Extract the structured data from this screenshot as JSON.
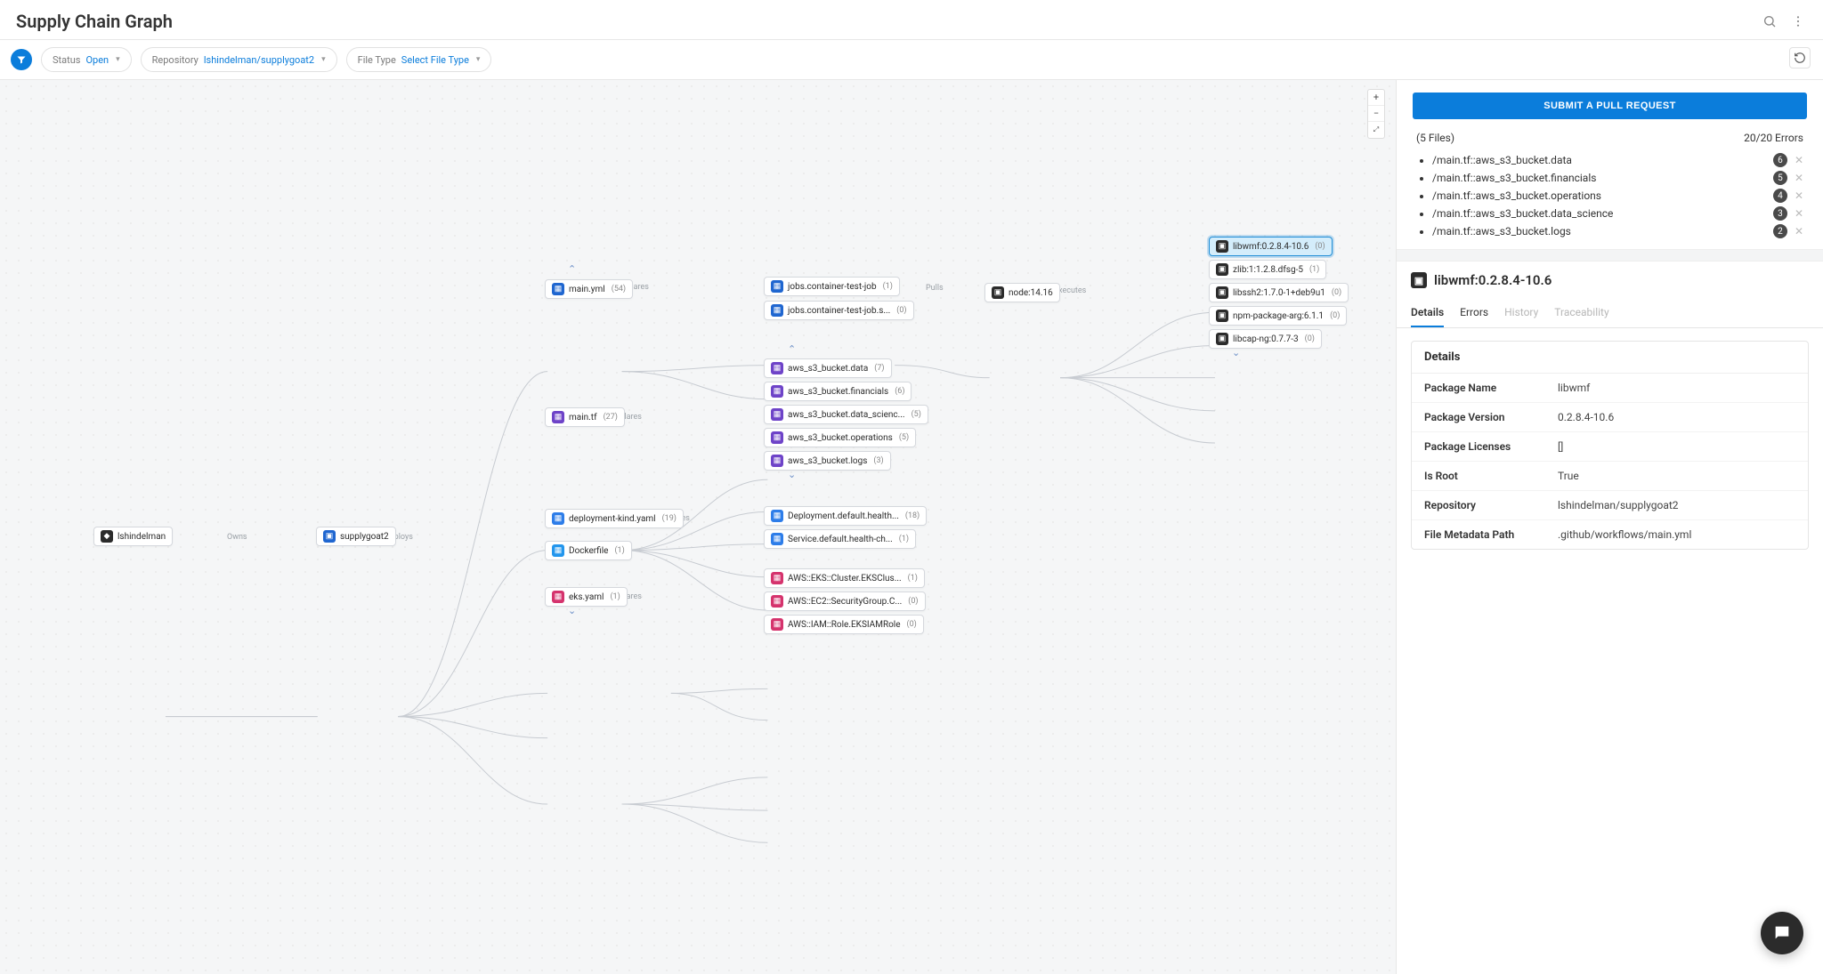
{
  "header": {
    "title": "Supply Chain Graph"
  },
  "filters": {
    "status_label": "Status",
    "status_value": "Open",
    "repo_label": "Repository",
    "repo_value": "lshindelman/supplygoat2",
    "filetype_label": "File Type",
    "filetype_value": "Select File Type"
  },
  "panel": {
    "submit": "SUBMIT A PULL REQUEST",
    "files_label": "(5 Files)",
    "errors_label": "20/20 Errors",
    "files": [
      {
        "path": "/main.tf::aws_s3_bucket.data",
        "count": "6"
      },
      {
        "path": "/main.tf::aws_s3_bucket.financials",
        "count": "5"
      },
      {
        "path": "/main.tf::aws_s3_bucket.operations",
        "count": "4"
      },
      {
        "path": "/main.tf::aws_s3_bucket.data_science",
        "count": "3"
      },
      {
        "path": "/main.tf::aws_s3_bucket.logs",
        "count": "2"
      }
    ],
    "selected_title": "libwmf:0.2.8.4-10.6",
    "tabs": {
      "details": "Details",
      "errors": "Errors",
      "history": "History",
      "traceability": "Traceability"
    },
    "details_heading": "Details",
    "details": [
      {
        "k": "Package Name",
        "v": "libwmf"
      },
      {
        "k": "Package Version",
        "v": "0.2.8.4-10.6"
      },
      {
        "k": "Package Licenses",
        "v": "[]"
      },
      {
        "k": "Is Root",
        "v": "True"
      },
      {
        "k": "Repository",
        "v": "lshindelman/supplygoat2"
      },
      {
        "k": "File Metadata Path",
        "v": ".github/workflows/main.yml"
      }
    ]
  },
  "edges": {
    "owns": "Owns",
    "deploys": "Deploys",
    "declares": "Declares",
    "pulls": "Pulls",
    "executes": "Executes"
  },
  "nodes": {
    "owner": {
      "label": "lshindelman",
      "count": ""
    },
    "repo": {
      "label": "supplygoat2",
      "count": ""
    },
    "mainyml": {
      "label": "main.yml",
      "count": "(54)"
    },
    "maintf": {
      "label": "main.tf",
      "count": "(27)"
    },
    "depkind": {
      "label": "deployment-kind.yaml",
      "count": "(19)"
    },
    "docker": {
      "label": "Dockerfile",
      "count": "(1)"
    },
    "eksyaml": {
      "label": "eks.yaml",
      "count": "(1)"
    },
    "job1": {
      "label": "jobs.container-test-job",
      "count": "(1)"
    },
    "job2": {
      "label": "jobs.container-test-job.s...",
      "count": "(0)"
    },
    "tf1": {
      "label": "aws_s3_bucket.data",
      "count": "(7)"
    },
    "tf2": {
      "label": "aws_s3_bucket.financials",
      "count": "(6)"
    },
    "tf3": {
      "label": "aws_s3_bucket.data_scienc...",
      "count": "(5)"
    },
    "tf4": {
      "label": "aws_s3_bucket.operations",
      "count": "(5)"
    },
    "tf5": {
      "label": "aws_s3_bucket.logs",
      "count": "(3)"
    },
    "k8s1": {
      "label": "Deployment.default.health...",
      "count": "(18)"
    },
    "k8s2": {
      "label": "Service.default.health-ch...",
      "count": "(1)"
    },
    "cfn1": {
      "label": "AWS::EKS::Cluster.EKSClus...",
      "count": "(1)"
    },
    "cfn2": {
      "label": "AWS::EC2::SecurityGroup.C...",
      "count": "(0)"
    },
    "cfn3": {
      "label": "AWS::IAM::Role.EKSIAMRole",
      "count": "(0)"
    },
    "node": {
      "label": "node:14.16",
      "count": ""
    },
    "pkg1": {
      "label": "libwmf:0.2.8.4-10.6",
      "count": "(0)"
    },
    "pkg2": {
      "label": "zlib:1:1.2.8.dfsg-5",
      "count": "(1)"
    },
    "pkg3": {
      "label": "libssh2:1.7.0-1+deb9u1",
      "count": "(0)"
    },
    "pkg4": {
      "label": "npm-package-arg:6.1.1",
      "count": "(0)"
    },
    "pkg5": {
      "label": "libcap-ng:0.7.7-3",
      "count": "(0)"
    }
  }
}
